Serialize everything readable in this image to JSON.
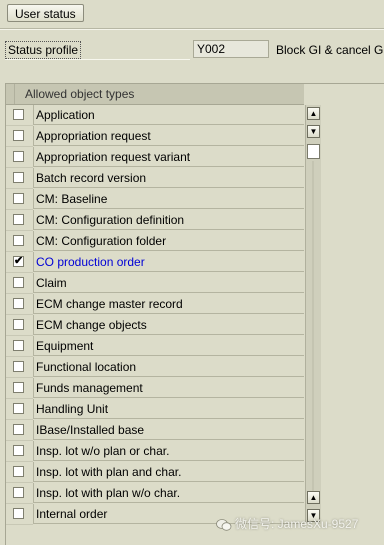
{
  "toolbar": {
    "user_status_button": "User status"
  },
  "status_profile": {
    "label": "Status profile",
    "value": "Y002",
    "description": "Block GI & cancel GI"
  },
  "table": {
    "header": "Allowed object types",
    "rows": [
      {
        "label": "Application",
        "checked": false
      },
      {
        "label": "Appropriation request",
        "checked": false
      },
      {
        "label": "Appropriation request variant",
        "checked": false
      },
      {
        "label": "Batch record version",
        "checked": false
      },
      {
        "label": "CM: Baseline",
        "checked": false
      },
      {
        "label": "CM: Configuration definition",
        "checked": false
      },
      {
        "label": "CM: Configuration folder",
        "checked": false
      },
      {
        "label": "CO production order",
        "checked": true
      },
      {
        "label": "Claim",
        "checked": false
      },
      {
        "label": "ECM change master record",
        "checked": false
      },
      {
        "label": "ECM change objects",
        "checked": false
      },
      {
        "label": "Equipment",
        "checked": false
      },
      {
        "label": "Functional location",
        "checked": false
      },
      {
        "label": "Funds management",
        "checked": false
      },
      {
        "label": "Handling Unit",
        "checked": false
      },
      {
        "label": "IBase/Installed base",
        "checked": false
      },
      {
        "label": "Insp. lot w/o plan or char.",
        "checked": false
      },
      {
        "label": "Insp. lot with plan and char.",
        "checked": false
      },
      {
        "label": "Insp. lot with plan w/o char.",
        "checked": false
      },
      {
        "label": "Internal order",
        "checked": false
      }
    ]
  },
  "colors": {
    "background": "#dcdcc9",
    "selected_text": "#0000d6"
  },
  "watermark": {
    "text": "微信号: JamesXu-9527",
    "icon": "wechat-icon"
  }
}
